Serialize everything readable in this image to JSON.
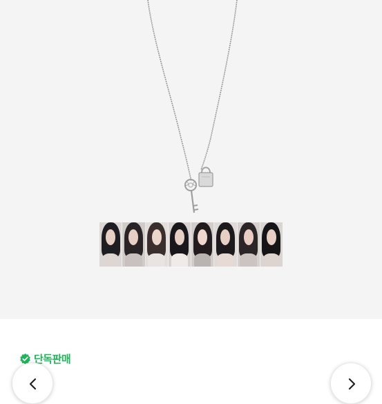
{
  "product": {
    "badge": {
      "label": "단독판매",
      "color": "#1fb45a",
      "icon": "check-badge-icon"
    },
    "image": {
      "subject": "necklace-with-key-and-lock-pendant",
      "photocards": 8
    },
    "navigation": {
      "prev_icon": "chevron-left-icon",
      "next_icon": "chevron-right-icon"
    }
  }
}
